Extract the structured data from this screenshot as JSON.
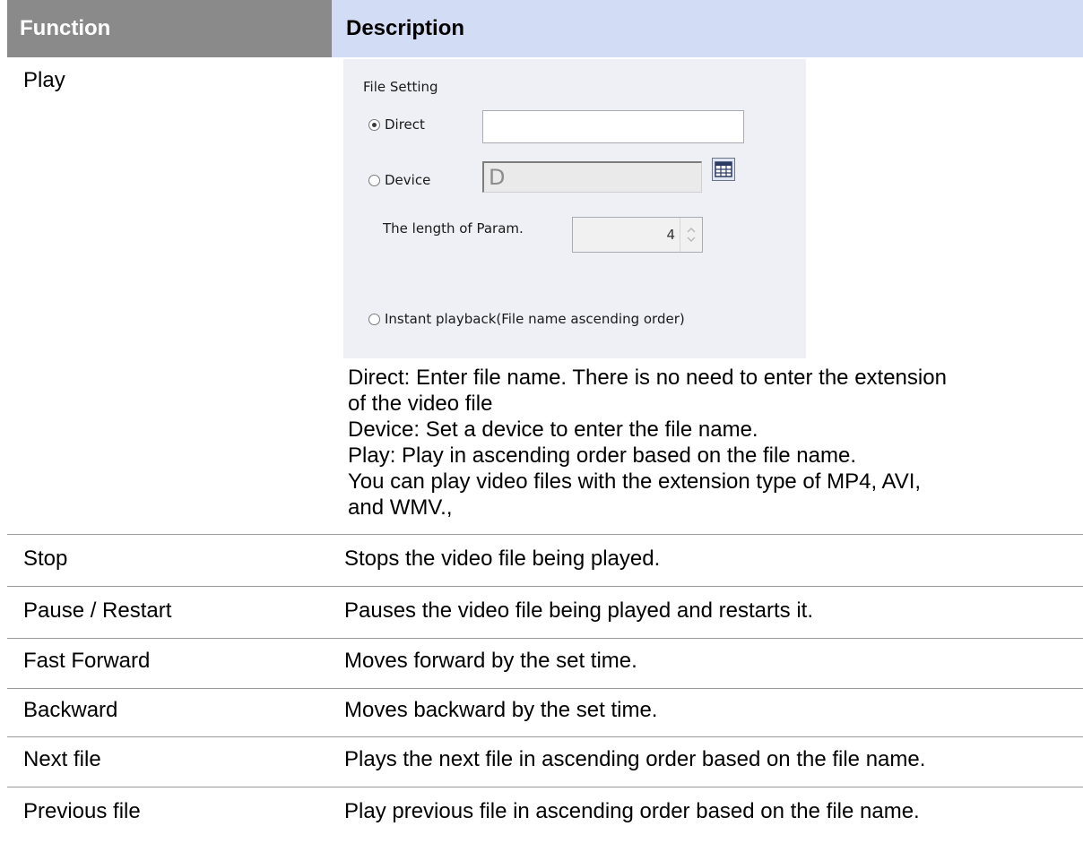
{
  "table": {
    "headers": {
      "function": "Function",
      "description": "Description"
    },
    "play": {
      "function": "Play",
      "panel": {
        "title": "File Setting",
        "direct_label": "Direct",
        "direct_value": "",
        "device_label": "Device",
        "device_value": "D",
        "device_button_icon": "device-browse-icon",
        "param_label": "The length of Param.",
        "param_value": "4",
        "instant_label": "Instant playback(File name ascending order)",
        "selected_option": "Direct"
      },
      "description_lines": [
        "Direct: Enter file name. There is no need to enter the extension",
        "of the video file",
        "Device: Set a device to enter the file name.",
        "Play: Play in ascending order based on the file name.",
        "You can play video files with the extension type of MP4, AVI,",
        "and WMV.,"
      ]
    },
    "rows": [
      {
        "function": "Stop",
        "description": "Stops the video file being played."
      },
      {
        "function": "Pause / Restart",
        "description": "Pauses the video file being played and restarts it."
      },
      {
        "function": "Fast Forward",
        "description": "Moves forward by the set time."
      },
      {
        "function": "Backward",
        "description": "Moves backward by the set time."
      },
      {
        "function": "Next file",
        "description": "Plays the next file in ascending order based on the file name."
      },
      {
        "function": "Previous file",
        "description": "Play previous file in ascending order based on the file name."
      }
    ]
  },
  "colors": {
    "function_header_bg": "#8a8a8a",
    "description_header_bg": "#d2dcf5",
    "panel_bg": "#eef0f6",
    "row_rule": "#9a9a9a"
  }
}
